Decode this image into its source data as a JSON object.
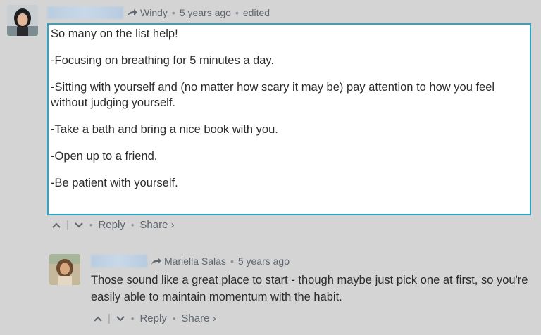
{
  "comment": {
    "author_name": "",
    "replying_to": "Windy",
    "time": "5 years ago",
    "edited": "edited",
    "paragraphs": [
      "So many on the list help!",
      "-Focusing on breathing for 5 minutes a day.",
      "-Sitting with yourself and (no matter how scary it may be) pay attention to how you feel without judging yourself.",
      "-Take a bath and bring a nice book with you.",
      "-Open up to a friend.",
      "-Be patient with yourself."
    ],
    "actions": {
      "reply": "Reply",
      "share": "Share ›"
    }
  },
  "reply": {
    "author_name": "",
    "replying_to": "Mariella Salas",
    "time": "5 years ago",
    "text": "Those sound like a great place to start - though maybe just pick one at first, so you're easily able to maintain momentum with the habit.",
    "actions": {
      "reply": "Reply",
      "share": "Share ›"
    }
  },
  "colors": {
    "highlight_border": "#2aa7c6",
    "background": "#d4d4d4",
    "meta_text": "#5f6670"
  }
}
